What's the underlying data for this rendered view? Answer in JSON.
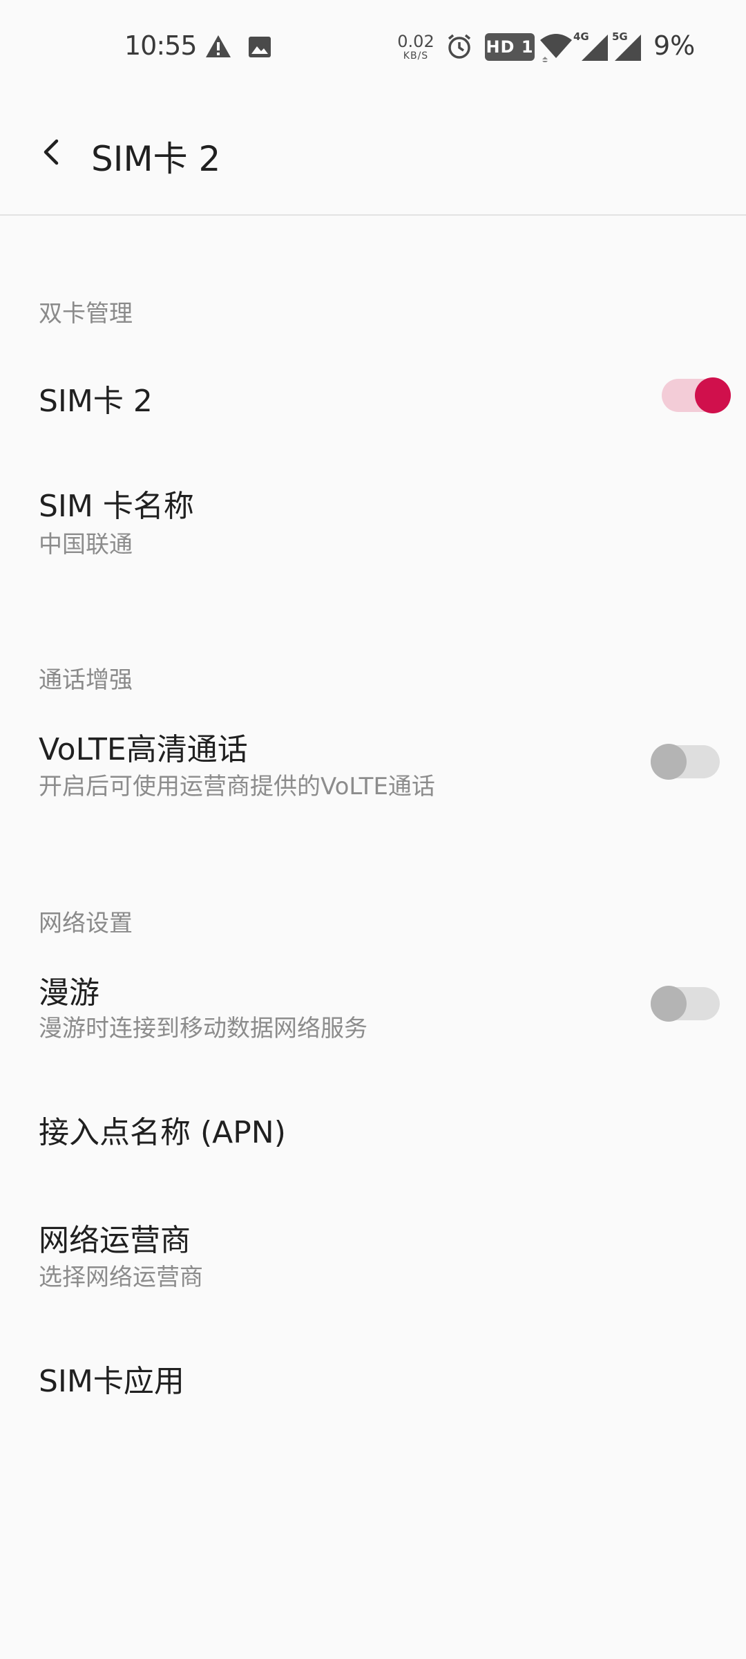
{
  "status_bar": {
    "time": "10:55",
    "net_speed_value": "0.02",
    "net_speed_unit": "KB/S",
    "hd_badge": "HD 1",
    "signal_4g_label": "4G",
    "signal_5g_label": "5G",
    "battery": "9%",
    "icons": [
      "warning-icon",
      "image-icon",
      "alarm-icon",
      "wifi-icon",
      "signal-4g-icon",
      "signal-5g-icon"
    ]
  },
  "app_bar": {
    "title": "SIM卡 2",
    "back_icon": "chevron-left-icon"
  },
  "sections": {
    "dual_sim": {
      "header": "双卡管理",
      "sim_toggle_title": "SIM卡 2",
      "sim_toggle_on": true,
      "sim_name_title": "SIM 卡名称",
      "sim_name_value": "中国联通"
    },
    "call": {
      "header": "通话增强",
      "volte_title": "VoLTE高清通话",
      "volte_summary": "开启后可使用运营商提供的VoLTE通话",
      "volte_on": false
    },
    "network": {
      "header": "网络设置",
      "roaming_title": "漫游",
      "roaming_summary": "漫游时连接到移动数据网络服务",
      "roaming_on": false,
      "apn_title": "接入点名称 (APN)",
      "operator_title": "网络运营商",
      "operator_summary": "选择网络运营商",
      "sim_apps_title": "SIM卡应用"
    }
  },
  "colors": {
    "accent": "#d0104c",
    "accent_track": "#f3ccd7",
    "switch_off_thumb": "#b4b4b4",
    "switch_off_track": "#dedede",
    "background": "#fafafa"
  }
}
